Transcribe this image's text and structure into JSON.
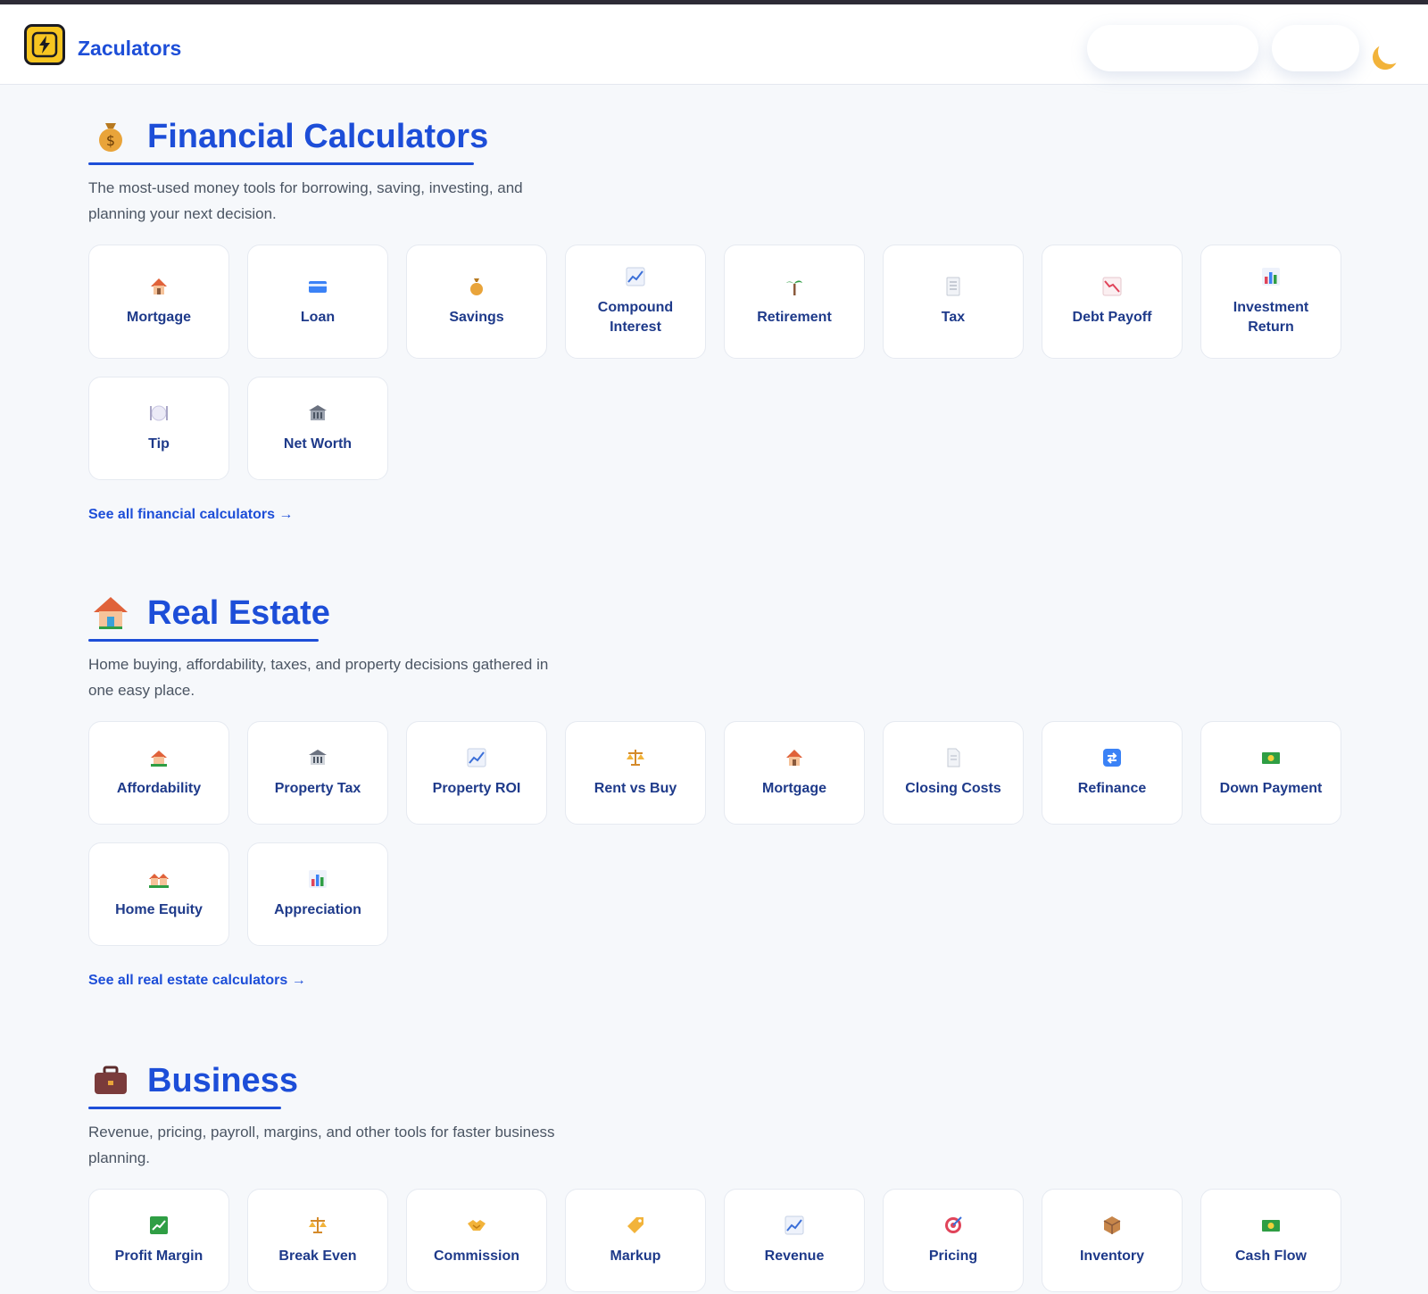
{
  "header": {
    "brand": "Zaculators",
    "logo_icon": "lightning-bolt-icon",
    "theme_toggle_icon": "moon-icon"
  },
  "sections": [
    {
      "icon": "money-bag-icon",
      "title": "Financial Calculators",
      "description": "The most-used money tools for borrowing, saving, investing, and planning your next decision.",
      "cards": [
        {
          "label": "Mortgage",
          "icon": "house-icon"
        },
        {
          "label": "Loan",
          "icon": "credit-card-icon"
        },
        {
          "label": "Savings",
          "icon": "money-bag-icon"
        },
        {
          "label": "Compound Interest",
          "icon": "chart-up-icon"
        },
        {
          "label": "Retirement",
          "icon": "palm-tree-icon"
        },
        {
          "label": "Tax",
          "icon": "document-icon"
        },
        {
          "label": "Debt Payoff",
          "icon": "chart-down-icon"
        },
        {
          "label": "Investment Return",
          "icon": "bar-chart-icon"
        },
        {
          "label": "Tip",
          "icon": "plate-icon"
        },
        {
          "label": "Net Worth",
          "icon": "bank-icon"
        }
      ],
      "see_all": "See all financial calculators →"
    },
    {
      "icon": "house-icon",
      "title": "Real Estate",
      "description": "Home buying, affordability, taxes, and property decisions gathered in one easy place.",
      "cards": [
        {
          "label": "Affordability",
          "icon": "house-garden-icon"
        },
        {
          "label": "Property Tax",
          "icon": "bank-icon"
        },
        {
          "label": "Property ROI",
          "icon": "chart-up-icon"
        },
        {
          "label": "Rent vs Buy",
          "icon": "scales-icon"
        },
        {
          "label": "Mortgage",
          "icon": "house-icon"
        },
        {
          "label": "Closing Costs",
          "icon": "page-icon"
        },
        {
          "label": "Refinance",
          "icon": "repeat-icon"
        },
        {
          "label": "Down Payment",
          "icon": "banknote-icon"
        },
        {
          "label": "Home Equity",
          "icon": "houses-icon"
        },
        {
          "label": "Appreciation",
          "icon": "bar-chart-icon"
        }
      ],
      "see_all": "See all real estate calculators →"
    },
    {
      "icon": "briefcase-icon",
      "title": "Business",
      "description": "Revenue, pricing, payroll, margins, and other tools for faster business planning.",
      "cards": [
        {
          "label": "Profit Margin",
          "icon": "chart-up-green-icon"
        },
        {
          "label": "Break Even",
          "icon": "scales-icon"
        },
        {
          "label": "Commission",
          "icon": "handshake-icon"
        },
        {
          "label": "Markup",
          "icon": "tag-icon"
        },
        {
          "label": "Revenue",
          "icon": "chart-up-icon"
        },
        {
          "label": "Pricing",
          "icon": "target-icon"
        },
        {
          "label": "Inventory",
          "icon": "package-icon"
        },
        {
          "label": "Cash Flow",
          "icon": "banknote-icon"
        }
      ],
      "see_all": ""
    }
  ]
}
